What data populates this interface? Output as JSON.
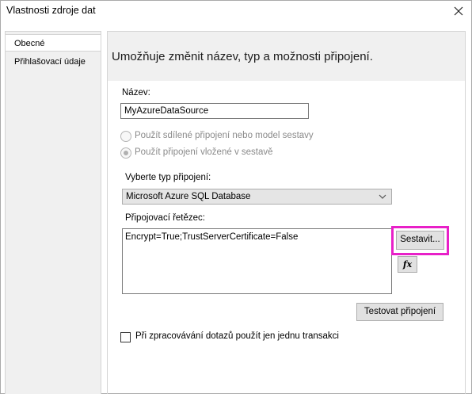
{
  "window": {
    "title": "Vlastnosti zdroje dat",
    "close_icon": "close-icon"
  },
  "sidebar": {
    "items": [
      {
        "label": "Obecné",
        "selected": true
      },
      {
        "label": "Přihlašovací údaje",
        "selected": false
      }
    ]
  },
  "panel": {
    "description": "Umožňuje změnit název, typ a možnosti připojení.",
    "name_label": "Název:",
    "name_value": "MyAzureDataSource",
    "radio_shared_label": "Použít sdílené připojení nebo model sestavy",
    "radio_embedded_label": "Použít připojení vložené v sestavě",
    "conn_type_label": "Vyberte typ připojení:",
    "conn_type_value": "Microsoft Azure SQL Database",
    "conn_string_label": "Připojovací řetězec:",
    "conn_string_value": "Encrypt=True;TrustServerCertificate=False",
    "build_button": "Sestavit...",
    "fx_button": "fx",
    "test_button": "Testovat připojení",
    "single_transaction_label": "Při zpracovávání dotazů použít jen jednu transakci"
  },
  "colors": {
    "highlight": "#e820c8",
    "header_bg": "#f0f0f0"
  }
}
